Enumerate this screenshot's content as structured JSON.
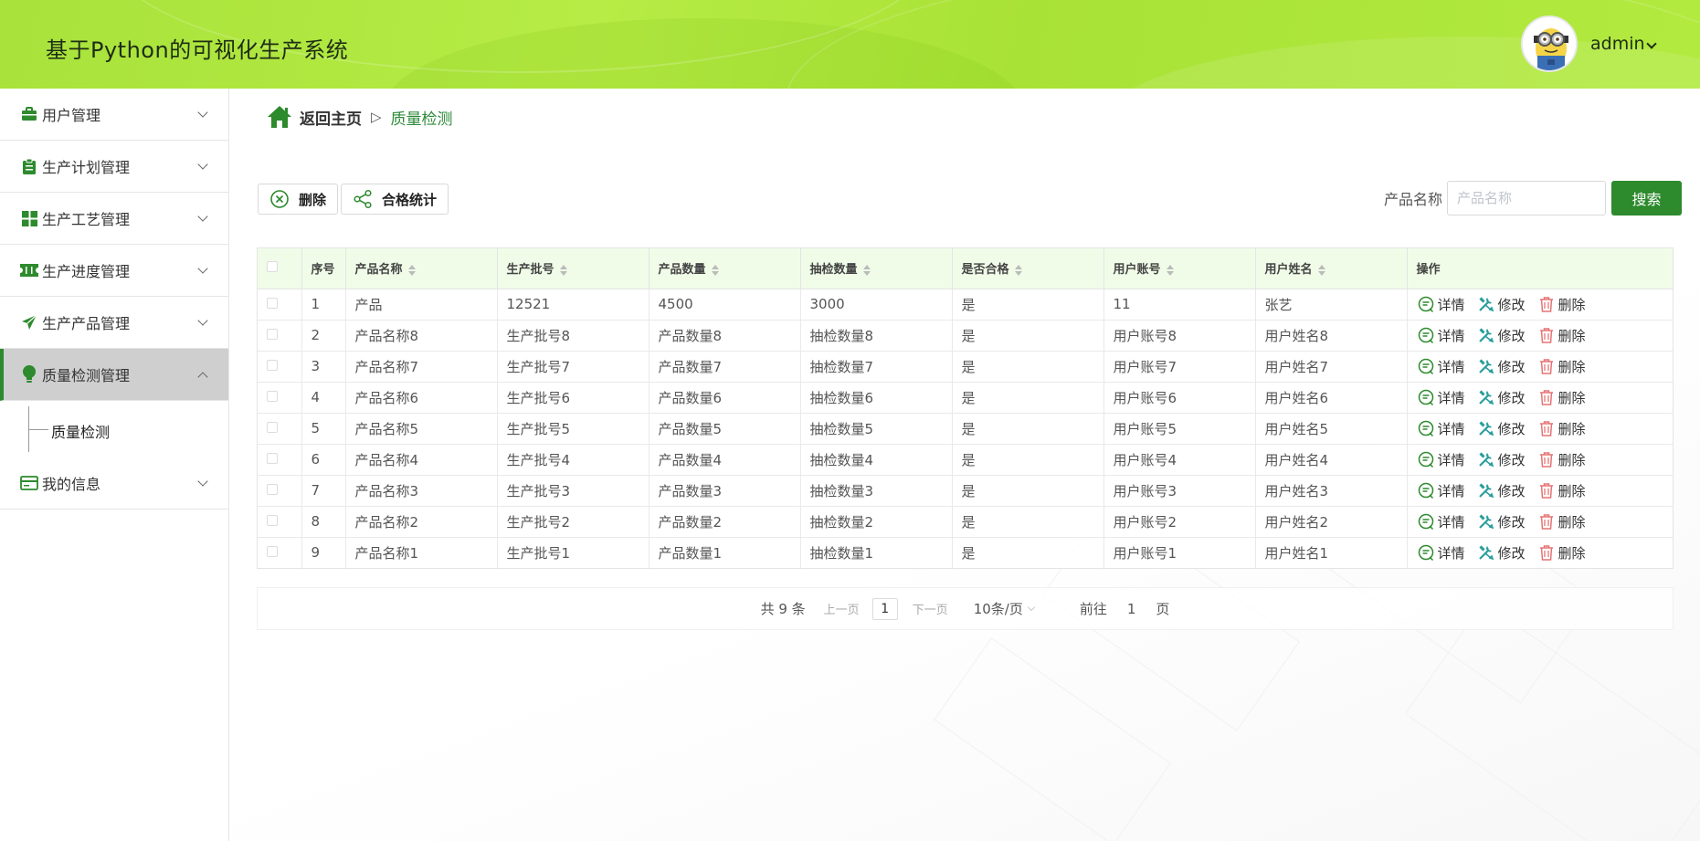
{
  "app": {
    "title": "基于Python的可视化生产系统"
  },
  "user": {
    "name": "admin"
  },
  "colors": {
    "primary": "#2d8a2d",
    "header": "#b2ea40",
    "breadcrumb_active": "#2f8a3a",
    "table_header": "#f0fce8"
  },
  "sidebar": {
    "items": [
      {
        "label": "用户管理",
        "icon": "briefcase-icon"
      },
      {
        "label": "生产计划管理",
        "icon": "clipboard-icon"
      },
      {
        "label": "生产工艺管理",
        "icon": "grid-icon"
      },
      {
        "label": "生产进度管理",
        "icon": "ticket-icon"
      },
      {
        "label": "生产产品管理",
        "icon": "send-icon"
      },
      {
        "label": "质量检测管理",
        "icon": "lightbulb-icon",
        "active": true,
        "children": [
          {
            "label": "质量检测"
          }
        ]
      },
      {
        "label": "我的信息",
        "icon": "card-icon"
      }
    ]
  },
  "breadcrumb": {
    "home": "返回主页",
    "separator": "▷",
    "current": "质量检测"
  },
  "toolbar": {
    "delete_label": "删除",
    "stats_label": "合格统计"
  },
  "search": {
    "label": "产品名称",
    "placeholder": "产品名称",
    "button": "搜索"
  },
  "table": {
    "columns": [
      "序号",
      "产品名称",
      "生产批号",
      "产品数量",
      "抽检数量",
      "是否合格",
      "用户账号",
      "用户姓名",
      "操作"
    ],
    "rows": [
      [
        "1",
        "产品",
        "12521",
        "4500",
        "3000",
        "是",
        "11",
        "张艺"
      ],
      [
        "2",
        "产品名称8",
        "生产批号8",
        "产品数量8",
        "抽检数量8",
        "是",
        "用户账号8",
        "用户姓名8"
      ],
      [
        "3",
        "产品名称7",
        "生产批号7",
        "产品数量7",
        "抽检数量7",
        "是",
        "用户账号7",
        "用户姓名7"
      ],
      [
        "4",
        "产品名称6",
        "生产批号6",
        "产品数量6",
        "抽检数量6",
        "是",
        "用户账号6",
        "用户姓名6"
      ],
      [
        "5",
        "产品名称5",
        "生产批号5",
        "产品数量5",
        "抽检数量5",
        "是",
        "用户账号5",
        "用户姓名5"
      ],
      [
        "6",
        "产品名称4",
        "生产批号4",
        "产品数量4",
        "抽检数量4",
        "是",
        "用户账号4",
        "用户姓名4"
      ],
      [
        "7",
        "产品名称3",
        "生产批号3",
        "产品数量3",
        "抽检数量3",
        "是",
        "用户账号3",
        "用户姓名3"
      ],
      [
        "8",
        "产品名称2",
        "生产批号2",
        "产品数量2",
        "抽检数量2",
        "是",
        "用户账号2",
        "用户姓名2"
      ],
      [
        "9",
        "产品名称1",
        "生产批号1",
        "产品数量1",
        "抽检数量1",
        "是",
        "用户账号1",
        "用户姓名1"
      ]
    ],
    "actions": {
      "detail": "详情",
      "edit": "修改",
      "delete": "删除"
    }
  },
  "pagination": {
    "total": "共 9 条",
    "prev": "上一页",
    "current_page": "1",
    "next": "下一页",
    "page_size": "10条/页",
    "goto": "前往",
    "goto_value": "1",
    "page_unit": "页"
  }
}
